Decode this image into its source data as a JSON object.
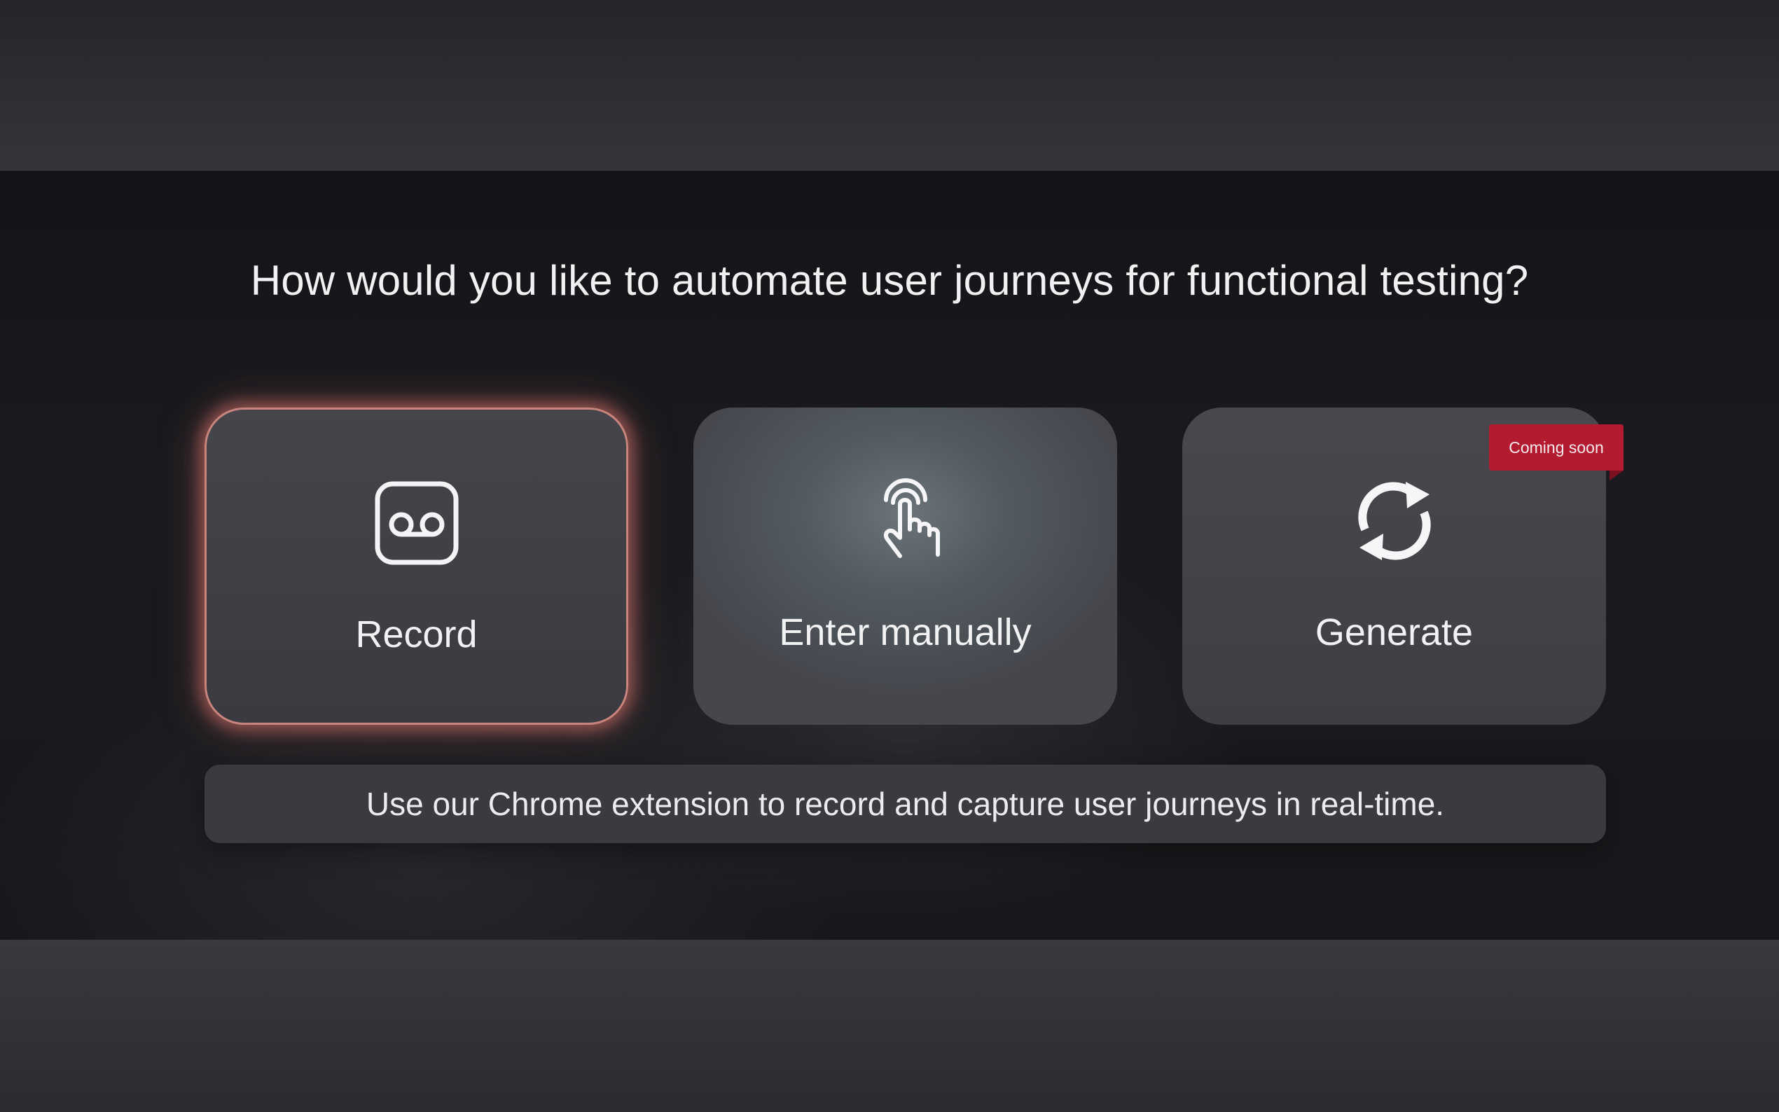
{
  "question": "How would you like to automate user journeys for functional testing?",
  "options": [
    {
      "label": "Record",
      "icon": "voicemail-icon",
      "selected": true
    },
    {
      "label": "Enter manually",
      "icon": "tap-hand-icon",
      "selected": false
    },
    {
      "label": "Generate",
      "icon": "refresh-icon",
      "selected": false,
      "badge": "Coming soon"
    }
  ],
  "description": "Use our Chrome extension to record and capture user journeys in real-time.",
  "colors": {
    "selected_glow": "#c9857d",
    "badge": "#b31b30",
    "card": "#44444a",
    "background": "#18181c"
  }
}
